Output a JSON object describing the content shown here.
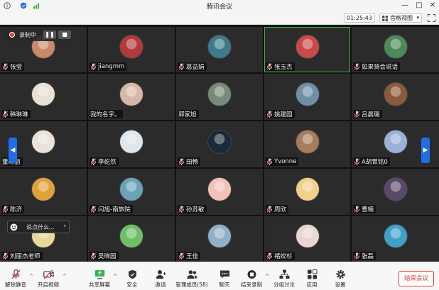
{
  "window": {
    "title": "腾讯会议"
  },
  "subbar": {
    "timer": "01:25:43",
    "view_label": "宫格视图"
  },
  "recording": {
    "label": "录制中"
  },
  "chat": {
    "placeholder": "说点什么..."
  },
  "participants": [
    {
      "name": "张莹",
      "color": "#c98a6b",
      "mic": true
    },
    {
      "name": "jiangmm",
      "color": "#b23a3a",
      "mic": true
    },
    {
      "name": "葛益娟",
      "color": "#3f7a8c",
      "mic": true
    },
    {
      "name": "张玉杰",
      "color": "#c94a4a",
      "mic": true,
      "active": true
    },
    {
      "name": "如果骑会说话",
      "color": "#4c8a5a",
      "mic": true
    },
    {
      "name": "韩琳琳",
      "color": "#e8e1d6",
      "mic": true
    },
    {
      "name": "我的名字。",
      "color": "#d7b8a8",
      "mic": false
    },
    {
      "name": "郭家旭",
      "color": "#7a8a7a",
      "mic": false
    },
    {
      "name": "姚建园",
      "color": "#6f8fa6",
      "mic": true
    },
    {
      "name": "吕晨璐",
      "color": "#8a5a3a",
      "mic": true
    },
    {
      "name": "董晓丽",
      "color": "#e9e2d8",
      "mic": false
    },
    {
      "name": "李屹然",
      "color": "#dfe6ec",
      "mic": true
    },
    {
      "name": "田畅",
      "color": "#1a2a3a",
      "mic": true
    },
    {
      "name": "Yvonne",
      "color": "#a67c5b",
      "mic": true
    },
    {
      "name": "A胡胃铭0",
      "color": "#9ab0d8",
      "mic": true
    },
    {
      "name": "陈济",
      "color": "#e2a23a",
      "mic": true
    },
    {
      "name": "闫旭-南旅院",
      "color": "#6aa3b8",
      "mic": true
    },
    {
      "name": "孙苏敏",
      "color": "#f2c2b8",
      "mic": true
    },
    {
      "name": "周欣",
      "color": "#f0d08a",
      "mic": true
    },
    {
      "name": "曹楠",
      "color": "#5a4a6a",
      "mic": true
    },
    {
      "name": "刘丽杰老师",
      "color": "#e8d89a",
      "mic": true
    },
    {
      "name": "吴晓园",
      "color": "#6fbf6a",
      "mic": true
    },
    {
      "name": "王佳",
      "color": "#8fb0c8",
      "mic": true
    },
    {
      "name": "褚姣杉",
      "color": "#e8d6d0",
      "mic": true
    },
    {
      "name": "张磊",
      "color": "#3fa0c8",
      "mic": true
    }
  ],
  "toolbar": {
    "unmute": "解除静音",
    "video": "开启视频",
    "share": "共享屏幕",
    "security": "安全",
    "invite": "邀请",
    "members": "管理成员(58)",
    "chat": "聊天",
    "record": "结束录制",
    "breakout": "分组讨论",
    "apps": "应用",
    "settings": "设置",
    "end": "结束会议"
  }
}
